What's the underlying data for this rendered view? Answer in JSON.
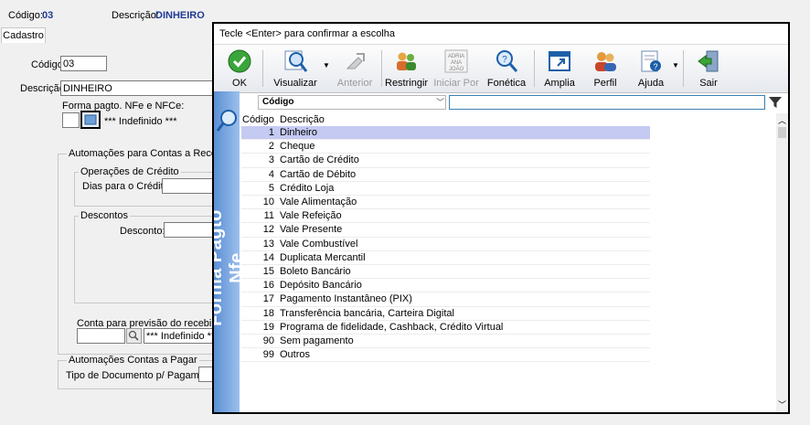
{
  "header": {
    "codigo_label": "Código:",
    "codigo_value": "03",
    "descricao_label": "Descrição:",
    "descricao_value": "DINHEIRO"
  },
  "tabs": [
    {
      "label": "Cadastro"
    }
  ],
  "form": {
    "codigo_label": "Código:",
    "codigo_value": "03",
    "descricao_label": "Descrição:",
    "descricao_value": "DINHEIRO",
    "forma_label": "Forma pagto. NFe e NFCe:",
    "forma_value": "*** Indefinido ***",
    "receber_group": "Automações para Contas a Receber",
    "credito_group": "Operações de Crédito",
    "dias_label": "Dias para o Crédito:",
    "descontos_group": "Descontos",
    "desconto_label": "Desconto:",
    "conta_label": "Conta para previsão do recebimento",
    "conta_value": "*** Indefinido ***",
    "pagar_group": "Automações Contas a Pagar",
    "tipo_label": "Tipo de Documento p/ Pagamento:"
  },
  "popup": {
    "title": "Tecle <Enter> para confirmar a escolha",
    "side_text": "Forma Pagto Nfe",
    "toolbar": [
      {
        "label": "OK",
        "icon": "ok-check-icon",
        "enabled": true
      },
      {
        "label": "Visualizar",
        "icon": "magnifier-icon",
        "enabled": true
      },
      {
        "label": "Anterior",
        "icon": "back-arrow-icon",
        "enabled": false
      },
      {
        "label": "Restringir",
        "icon": "restrict-users-icon",
        "enabled": true
      },
      {
        "label": "Iniciar Por",
        "icon": "alphabet-icon",
        "enabled": false
      },
      {
        "label": "Fonética",
        "icon": "phonetic-search-icon",
        "enabled": true
      },
      {
        "label": "Amplia",
        "icon": "maximize-icon",
        "enabled": true
      },
      {
        "label": "Perfil",
        "icon": "profile-icon",
        "enabled": true
      },
      {
        "label": "Ajuda",
        "icon": "help-icon",
        "enabled": true
      },
      {
        "label": "Sair",
        "icon": "exit-icon",
        "enabled": true
      }
    ],
    "field_select": "Código",
    "search_value": "",
    "columns": [
      "Código",
      "Descrição"
    ],
    "rows": [
      {
        "codigo": "1",
        "descricao": "Dinheiro",
        "selected": true
      },
      {
        "codigo": "2",
        "descricao": "Cheque"
      },
      {
        "codigo": "3",
        "descricao": "Cartão de Crédito"
      },
      {
        "codigo": "4",
        "descricao": "Cartão de Débito"
      },
      {
        "codigo": "5",
        "descricao": "Crédito Loja"
      },
      {
        "codigo": "10",
        "descricao": "Vale Alimentação"
      },
      {
        "codigo": "11",
        "descricao": "Vale Refeição"
      },
      {
        "codigo": "12",
        "descricao": "Vale Presente"
      },
      {
        "codigo": "13",
        "descricao": "Vale Combustível"
      },
      {
        "codigo": "14",
        "descricao": "Duplicata Mercantil"
      },
      {
        "codigo": "15",
        "descricao": "Boleto Bancário"
      },
      {
        "codigo": "16",
        "descricao": "Depósito Bancário"
      },
      {
        "codigo": "17",
        "descricao": "Pagamento Instantâneo (PIX)"
      },
      {
        "codigo": "18",
        "descricao": "Transferência bancária, Carteira Digital"
      },
      {
        "codigo": "19",
        "descricao": "Programa de fidelidade, Cashback, Crédito Virtual"
      },
      {
        "codigo": "90",
        "descricao": "Sem pagamento"
      },
      {
        "codigo": "99",
        "descricao": "Outros"
      }
    ]
  },
  "colors": {
    "selected_row": "#c5caf3",
    "side_banner": "#5b8fd4",
    "header_value": "#1f3a93"
  }
}
